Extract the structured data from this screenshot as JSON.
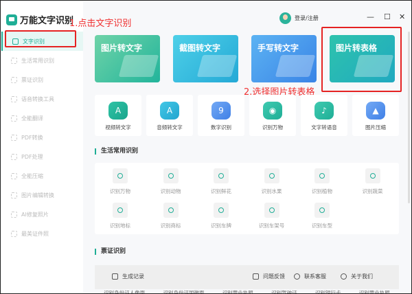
{
  "app": {
    "title": "万能文字识别"
  },
  "header": {
    "login": "登录/注册"
  },
  "window_controls": {
    "minimize": "—",
    "maximize": "☐",
    "close": "✕"
  },
  "sidebar": {
    "items": [
      {
        "label": "文字识别",
        "active": true
      },
      {
        "label": "生活常用识别"
      },
      {
        "label": "票证识别"
      },
      {
        "label": "语音转换工具"
      },
      {
        "label": "全能翻译"
      },
      {
        "label": "PDF转换"
      },
      {
        "label": "PDF处理"
      },
      {
        "label": "全能压缩"
      },
      {
        "label": "图片编辑转换"
      },
      {
        "label": "AI修复照片"
      },
      {
        "label": "最美证件照"
      }
    ]
  },
  "annotations": {
    "step1": "1.点击文字识别",
    "step2": "2.选择图片转表格",
    "color": "#e52222"
  },
  "banners": [
    {
      "label": "图片转文字"
    },
    {
      "label": "截图转文字"
    },
    {
      "label": "手写转文字"
    },
    {
      "label": "图片转表格"
    }
  ],
  "tools": [
    {
      "label": "视频转文字",
      "glyph": "A"
    },
    {
      "label": "音频转文字",
      "glyph": "A"
    },
    {
      "label": "数字识别",
      "glyph": "9"
    },
    {
      "label": "识别万物",
      "glyph": "◉"
    },
    {
      "label": "文字转语音",
      "glyph": "♪"
    },
    {
      "label": "图片压缩",
      "glyph": "▲"
    }
  ],
  "life_section": {
    "title": "生活常用识别",
    "items": [
      "识别万物",
      "识别动物",
      "识别鲜花",
      "识别水果",
      "识别植物",
      "识别蔬菜",
      "识别地标",
      "识别商标",
      "识别车牌",
      "识别车架号",
      "识别车型"
    ]
  },
  "ticket_section": {
    "title": "票证识别",
    "items": [
      "识别身份证人像面",
      "识别身份证国徽面",
      "识别营业执照",
      "识别驾驶证",
      "识别银行卡",
      "识别营业执照"
    ]
  },
  "footer": {
    "history": "生成记录",
    "feedback": "问题反馈",
    "support": "联系客服",
    "about": "关于我们"
  },
  "colors": {
    "accent": "#1fae96"
  }
}
